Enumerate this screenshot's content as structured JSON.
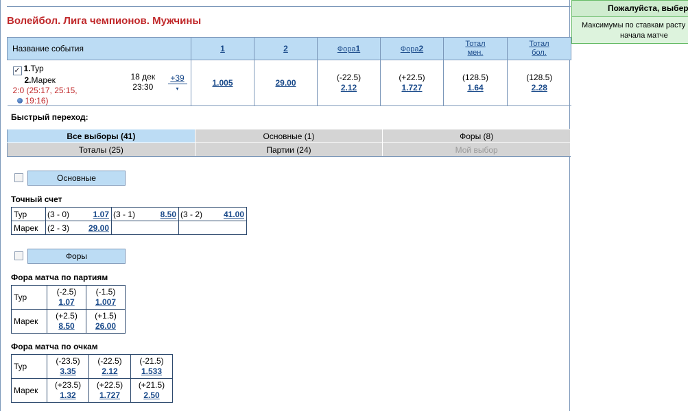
{
  "notice": {
    "title": "Пожалуйста, выбери",
    "line1": "Максимумы по ставкам расту",
    "line2": "начала матче"
  },
  "title": "Волейбол. Лига чемпионов. Мужчины",
  "event_table": {
    "headers": {
      "name": "Название события",
      "h1": "1",
      "h2": "2",
      "fora1_a": "Фора",
      "fora1_b": "1",
      "fora2_a": "Фора",
      "fora2_b": "2",
      "tot_m_a": "Тотал",
      "tot_m_b": "мен.",
      "tot_b_a": "Тотал",
      "tot_b_b": "бол."
    },
    "row": {
      "team1_num": "1.",
      "team1": "Тур",
      "team2_num": "2.",
      "team2": "Марек",
      "score": "2:0 (25:17, 25:15,",
      "score2": "19:16)",
      "date": "18 дек",
      "time": "23:30",
      "more": "+39",
      "more_arrow": "▾",
      "odd1": "1.005",
      "odd2": "29.00",
      "fora1_h": "(-22.5)",
      "fora1_o": "2.12",
      "fora2_h": "(+22.5)",
      "fora2_o": "1.727",
      "totm_h": "(128.5)",
      "totm_o": "1.64",
      "totb_h": "(128.5)",
      "totb_o": "2.28"
    }
  },
  "quick_jump": "Быстрый переход:",
  "tabs": {
    "all": "Все выборы (41)",
    "main": "Основные (1)",
    "foras": "Форы (8)",
    "totals": "Тоталы (25)",
    "parties": "Партии (24)",
    "my": "Мой выбор"
  },
  "section_main": {
    "button": "Основные",
    "exact_label": "Точный счет",
    "exact": {
      "t1": "Тур",
      "t2": "Марек",
      "r1": [
        [
          "(3 - 0)",
          "1.07"
        ],
        [
          "(3 - 1)",
          "8.50"
        ],
        [
          "(3 - 2)",
          "41.00"
        ]
      ],
      "r2": [
        [
          "(2 - 3)",
          "29.00"
        ]
      ]
    }
  },
  "section_foras": {
    "button": "Форы",
    "parties_label": "Фора матча по партиям",
    "parties": {
      "t1": "Тур",
      "t2": "Марек",
      "r1": [
        [
          "(-2.5)",
          "1.07"
        ],
        [
          "(-1.5)",
          "1.007"
        ]
      ],
      "r2": [
        [
          "(+2.5)",
          "8.50"
        ],
        [
          "(+1.5)",
          "26.00"
        ]
      ]
    },
    "points_label": "Фора матча по очкам",
    "points": {
      "t1": "Тур",
      "t2": "Марек",
      "r1": [
        [
          "(-23.5)",
          "3.35"
        ],
        [
          "(-22.5)",
          "2.12"
        ],
        [
          "(-21.5)",
          "1.533"
        ]
      ],
      "r2": [
        [
          "(+23.5)",
          "1.32"
        ],
        [
          "(+22.5)",
          "1.727"
        ],
        [
          "(+21.5)",
          "2.50"
        ]
      ]
    }
  }
}
